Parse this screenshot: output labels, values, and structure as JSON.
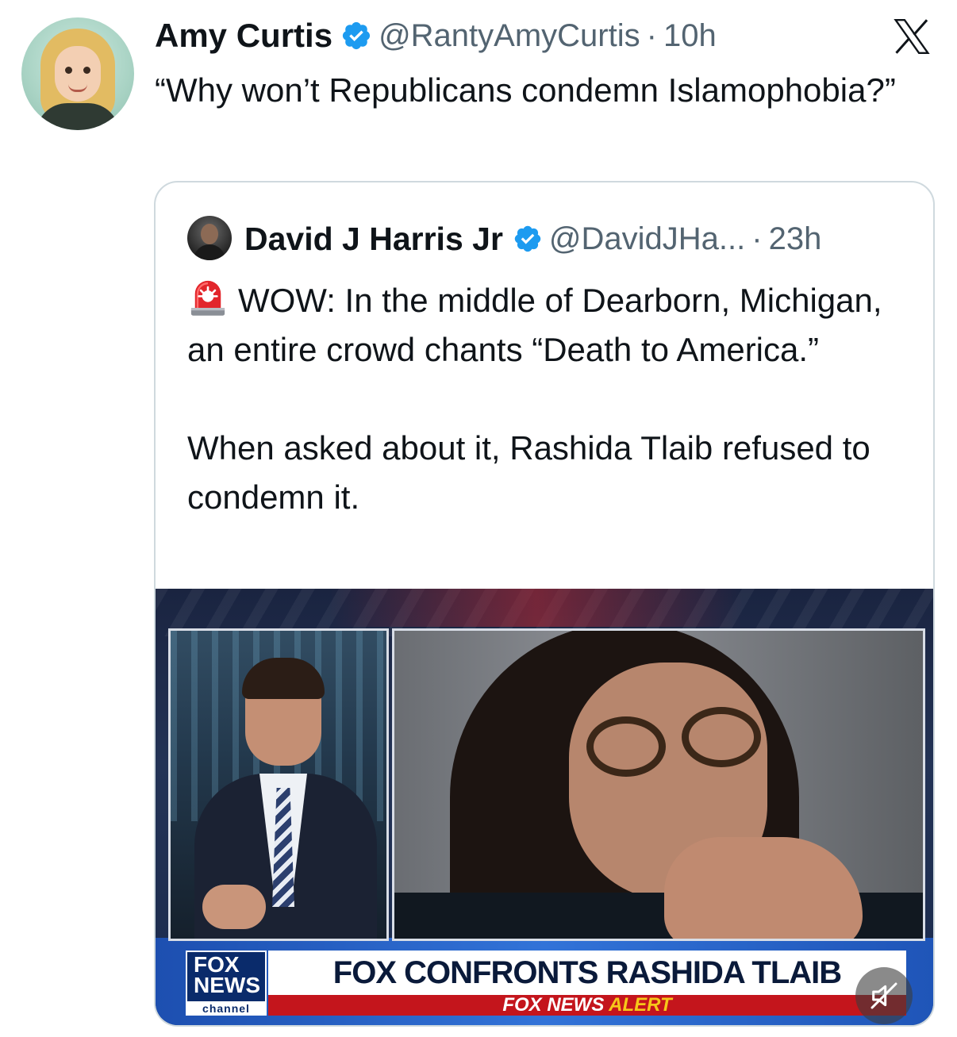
{
  "tweet": {
    "author_name": "Amy Curtis",
    "handle": "@RantyAmyCurtis",
    "separator": "·",
    "time": "10h",
    "text": "“Why won’t Republicans condemn Islamophobia?”"
  },
  "quoted_tweet": {
    "author_name": "David J Harris Jr",
    "handle": "@DavidJHa...",
    "separator": "·",
    "time": "23h",
    "paragraph_1": "WOW: In the middle of Dearborn, Michigan, an entire crowd chants “Death to America.”",
    "paragraph_2": "When asked about it, Rashida Tlaib refused to condemn it.",
    "emoji_icon": "rotating-light-icon"
  },
  "media": {
    "network_logo_line1": "FOX",
    "network_logo_line2": "NEWS",
    "network_logo_line3": "channel",
    "headline": "FOX CONFRONTS RASHIDA TLAIB",
    "alert_prefix": "FOX NEWS ",
    "alert_highlight": "ALERT",
    "mute_icon": "speaker-muted-icon"
  },
  "icons": {
    "verified": "verified-badge-icon",
    "platform": "x-logo-icon"
  },
  "colors": {
    "verified_blue": "#1d9bf0",
    "secondary_text": "#536471",
    "border": "#cfd9de",
    "fox_red": "#c4151c",
    "fox_blue": "#0a2b6b"
  }
}
